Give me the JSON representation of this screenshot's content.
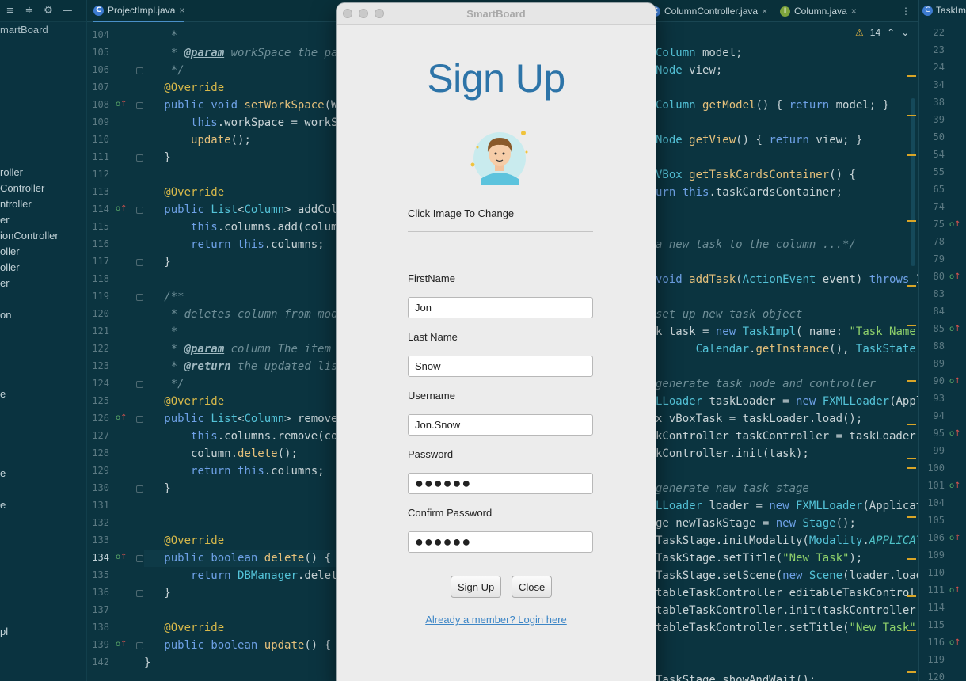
{
  "ide": {
    "project_root": "martBoard",
    "tree_items": [
      "roller",
      "Controller",
      "ntroller",
      "er",
      "ionController",
      "oller",
      "oller",
      "er",
      "on",
      "e",
      "e",
      "e",
      "pl"
    ],
    "tabs": [
      {
        "icon": "C",
        "label": "ProjectImpl.java"
      },
      {
        "icon": "C",
        "label": "ColumnController.java"
      },
      {
        "icon": "I",
        "label": "Column.java"
      },
      {
        "icon": "C",
        "label": "TaskIm"
      }
    ],
    "warning_count": "14",
    "left_line_numbers": [
      "104",
      "105",
      "106",
      "107",
      "108",
      "109",
      "110",
      "111",
      "112",
      "113",
      "114",
      "115",
      "116",
      "117",
      "118",
      "119",
      "120",
      "121",
      "122",
      "123",
      "124",
      "125",
      "126",
      "127",
      "128",
      "129",
      "130",
      "131",
      "132",
      "133",
      "134",
      "135",
      "136",
      "137",
      "138",
      "139",
      "142"
    ],
    "current_line": "134",
    "left_code": [
      "    *",
      "    * @param workSpace the par",
      "    */",
      "   @Override",
      "   public void setWorkSpace(Wo",
      "       this.workSpace = workSp",
      "       update();",
      "   }",
      "",
      "   @Override",
      "   public List<Column> addColu",
      "       this.columns.add(column",
      "       return this.columns;",
      "   }",
      "",
      "   /**",
      "    * deletes column from mode",
      "    *",
      "    * @param column The item t",
      "    * @return the updated list",
      "    */",
      "   @Override",
      "   public List<Column> removeC",
      "       this.columns.remove(col",
      "       column.delete();",
      "       return this.columns;",
      "   }",
      "",
      "",
      "   @Override",
      "   public boolean delete() {",
      "       return DBManager.delete",
      "   }",
      "",
      "   @Override",
      "   public boolean update() { r",
      "}"
    ],
    "right_code": [
      "",
      "Column model;",
      "Node view;",
      "",
      "Column getModel() { return model; }",
      "",
      "Node getView() { return view; }",
      "",
      "VBox getTaskCardsContainer() {",
      "urn this.taskCardsContainer;",
      "",
      "",
      "a new task to the column ...*/",
      "",
      "void addTask(ActionEvent event) throws IOE",
      "",
      "set up new task object",
      "k task = new TaskImpl( name: \"Task Name\", ",
      "      Calendar.getInstance(), TaskState.ACT",
      "",
      "generate task node and controller",
      "LLoader taskLoader = new FXMLLoader(Applica",
      "x vBoxTask = taskLoader.load();",
      "kController taskController = taskLoader.ge",
      "kController.init(task);",
      "",
      "generate new task stage",
      "LLoader loader = new FXMLLoader(Applicatio",
      "ge newTaskStage = new Stage();",
      "TaskStage.initModality(Modality.APPLICATIO",
      "TaskStage.setTitle(\"New Task\");",
      "TaskStage.setScene(new Scene(loader.load()",
      "tableTaskController editableTaskController",
      "tableTaskController.init(taskController);",
      "tableTaskController.setTitle(\"New Task\");",
      "",
      "",
      "TaskStage.showAndWait();"
    ],
    "right_panel_line_numbers": [
      "22",
      "23",
      "24",
      "34",
      "38",
      "39",
      "50",
      "54",
      "55",
      "65",
      "74",
      "75",
      "78",
      "79",
      "80",
      "83",
      "84",
      "85",
      "88",
      "89",
      "90",
      "93",
      "94",
      "95",
      "99",
      "100",
      "101",
      "104",
      "105",
      "106",
      "109",
      "110",
      "111",
      "114",
      "115",
      "116",
      "119",
      "120"
    ]
  },
  "dialog": {
    "window_title": "SmartBoard",
    "heading": "Sign Up",
    "avatar_caption": "Click Image To Change",
    "fields": {
      "first_name_label": "FirstName",
      "first_name_value": "Jon",
      "last_name_label": "Last Name",
      "last_name_value": "Snow",
      "username_label": "Username",
      "username_value": "Jon.Snow",
      "password_label": "Password",
      "password_value": "●●●●●●",
      "confirm_label": "Confirm Password",
      "confirm_value": "●●●●●●"
    },
    "signup_button": "Sign Up",
    "close_button": "Close",
    "login_link": "Already a member? Login here"
  },
  "colors": {
    "heading_blue": "#2d74a8",
    "link_blue": "#3d86c6",
    "ide_background": "#0b3440"
  }
}
